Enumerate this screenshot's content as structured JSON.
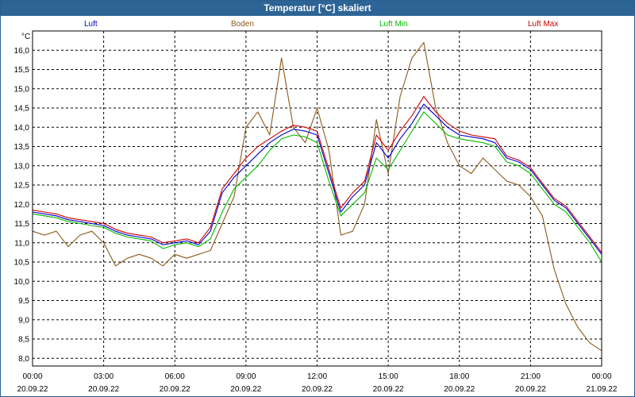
{
  "chart_data": {
    "type": "line",
    "title": "Temperatur [°C] skaliert",
    "ylabel": "°C",
    "ylim": [
      7.8,
      16.5
    ],
    "xlim": [
      0,
      24
    ],
    "grid": true,
    "legend_position": "top",
    "yticks": [
      "8,0",
      "8,5",
      "9,0",
      "9,5",
      "10,0",
      "10,5",
      "11,0",
      "11,5",
      "12,0",
      "12,5",
      "13,0",
      "13,5",
      "14,0",
      "14,5",
      "15,0",
      "15,5",
      "16,0"
    ],
    "ytick_values": [
      8.0,
      8.5,
      9.0,
      9.5,
      10.0,
      10.5,
      11.0,
      11.5,
      12.0,
      12.5,
      13.0,
      13.5,
      14.0,
      14.5,
      15.0,
      15.5,
      16.0
    ],
    "xticks": [
      {
        "x": 0,
        "time": "00:00",
        "date": "20.09.22"
      },
      {
        "x": 3,
        "time": "03:00",
        "date": "20.09.22"
      },
      {
        "x": 6,
        "time": "06:00",
        "date": "20.09.22"
      },
      {
        "x": 9,
        "time": "09:00",
        "date": "20.09.22"
      },
      {
        "x": 12,
        "time": "12:00",
        "date": "20.09.22"
      },
      {
        "x": 15,
        "time": "15:00",
        "date": "20.09.22"
      },
      {
        "x": 18,
        "time": "18:00",
        "date": "20.09.22"
      },
      {
        "x": 21,
        "time": "21:00",
        "date": "20.09.22"
      },
      {
        "x": 24,
        "time": "00:00",
        "date": "21.09.22"
      }
    ],
    "x": [
      0,
      0.5,
      1,
      1.5,
      2,
      2.5,
      3,
      3.5,
      4,
      4.5,
      5,
      5.5,
      6,
      6.5,
      7,
      7.5,
      8,
      8.5,
      9,
      9.5,
      10,
      10.5,
      11,
      11.5,
      12,
      12.5,
      13,
      13.5,
      14,
      14.5,
      15,
      15.5,
      16,
      16.5,
      17,
      17.5,
      18,
      18.5,
      19,
      19.5,
      20,
      20.5,
      21,
      21.5,
      22,
      22.5,
      23,
      23.5,
      24
    ],
    "series": [
      {
        "name": "Luft",
        "color": "#0000cc",
        "values": [
          11.8,
          11.75,
          11.7,
          11.6,
          11.55,
          11.5,
          11.45,
          11.3,
          11.2,
          11.15,
          11.1,
          10.95,
          11.0,
          11.05,
          10.95,
          11.3,
          12.3,
          12.7,
          13.0,
          13.3,
          13.6,
          13.8,
          13.95,
          13.9,
          13.8,
          12.8,
          11.8,
          12.2,
          12.5,
          13.6,
          13.2,
          13.7,
          14.1,
          14.6,
          14.3,
          14.0,
          13.8,
          13.75,
          13.7,
          13.6,
          13.2,
          13.1,
          12.9,
          12.5,
          12.1,
          11.9,
          11.5,
          11.1,
          10.7
        ]
      },
      {
        "name": "Boden",
        "color": "#8b5a1a",
        "values": [
          11.3,
          11.2,
          11.3,
          10.9,
          11.2,
          11.3,
          11.0,
          10.4,
          10.6,
          10.7,
          10.6,
          10.4,
          10.7,
          10.6,
          10.7,
          10.8,
          11.5,
          12.2,
          14.0,
          14.4,
          13.8,
          15.8,
          14.0,
          13.6,
          14.5,
          13.4,
          11.2,
          11.3,
          12.0,
          14.2,
          12.8,
          14.8,
          15.8,
          16.2,
          14.5,
          13.6,
          13.0,
          12.8,
          13.2,
          12.9,
          12.6,
          12.5,
          12.2,
          11.7,
          10.3,
          9.4,
          8.8,
          8.4,
          8.2
        ]
      },
      {
        "name": "Luft Min",
        "color": "#00bb00",
        "values": [
          11.75,
          11.7,
          11.65,
          11.55,
          11.5,
          11.45,
          11.4,
          11.25,
          11.15,
          11.1,
          11.05,
          10.85,
          10.95,
          11.0,
          10.9,
          11.1,
          11.8,
          12.4,
          12.7,
          13.0,
          13.4,
          13.7,
          13.8,
          13.75,
          13.6,
          12.6,
          11.7,
          12.0,
          12.3,
          13.2,
          12.9,
          13.4,
          13.9,
          14.4,
          14.1,
          13.8,
          13.7,
          13.65,
          13.6,
          13.5,
          13.1,
          13.0,
          12.8,
          12.4,
          12.0,
          11.8,
          11.4,
          11.0,
          10.5
        ]
      },
      {
        "name": "Luft Max",
        "color": "#cc0000",
        "values": [
          11.85,
          11.8,
          11.75,
          11.65,
          11.6,
          11.55,
          11.5,
          11.35,
          11.25,
          11.2,
          11.15,
          11.0,
          11.05,
          11.1,
          11.0,
          11.4,
          12.4,
          12.8,
          13.2,
          13.5,
          13.7,
          13.9,
          14.05,
          14.0,
          13.9,
          12.9,
          11.9,
          12.3,
          12.6,
          13.8,
          13.4,
          13.9,
          14.3,
          14.8,
          14.4,
          14.1,
          13.9,
          13.8,
          13.75,
          13.7,
          13.25,
          13.15,
          12.95,
          12.55,
          12.15,
          11.95,
          11.55,
          11.15,
          10.75
        ]
      }
    ]
  }
}
